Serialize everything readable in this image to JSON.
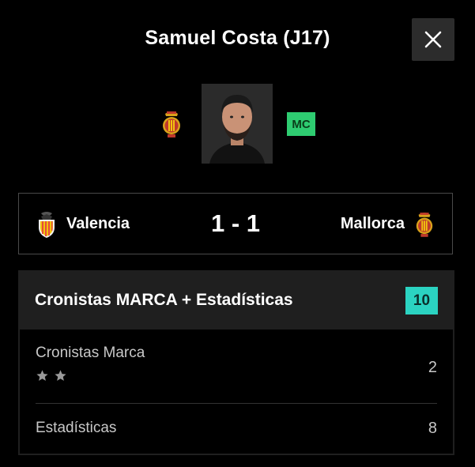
{
  "header": {
    "title": "Samuel Costa (J17)",
    "close_icon": "close-icon"
  },
  "player": {
    "team_crest_icon": "mallorca-crest-icon",
    "photo": "player-photo",
    "position_badge": "MC",
    "position_color": "#2ecc71"
  },
  "match": {
    "home_team": "Valencia",
    "home_crest_icon": "valencia-crest-icon",
    "score": "1 - 1",
    "away_team": "Mallorca",
    "away_crest_icon": "mallorca-crest-icon"
  },
  "rating": {
    "title": "Cronistas MARCA + Estadísticas",
    "total": "10",
    "total_color": "#2bd3c1",
    "rows": [
      {
        "label": "Cronistas Marca",
        "value": "2",
        "stars": 2,
        "star_icon": "star-icon"
      },
      {
        "label": "Estadísticas",
        "value": "8"
      }
    ]
  }
}
